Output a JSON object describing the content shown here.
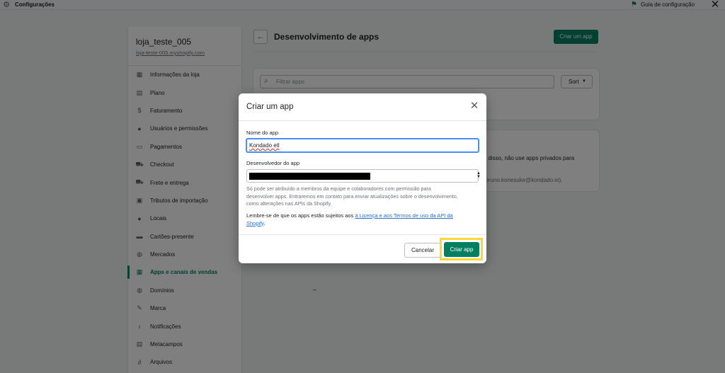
{
  "topbar": {
    "title": "Configurações",
    "guide_label": "Guia de configuração"
  },
  "sidebar": {
    "store_name": "loja_teste_005",
    "store_url": "loja-teste-005.myshopify.com",
    "items": [
      {
        "label": "Informações da loja",
        "icon": "store-icon",
        "active": false
      },
      {
        "label": "Plano",
        "icon": "plan-icon",
        "active": false
      },
      {
        "label": "Faturamento",
        "icon": "billing-icon",
        "active": false
      },
      {
        "label": "Usuários e permissões",
        "icon": "user-icon",
        "active": false
      },
      {
        "label": "Pagamentos",
        "icon": "payments-icon",
        "active": false
      },
      {
        "label": "Checkout",
        "icon": "cart-icon",
        "active": false
      },
      {
        "label": "Frete e entrega",
        "icon": "truck-icon",
        "active": false
      },
      {
        "label": "Tributos de importação",
        "icon": "duties-icon",
        "active": false
      },
      {
        "label": "Locais",
        "icon": "location-icon",
        "active": false
      },
      {
        "label": "Cartões-presente",
        "icon": "gift-card-icon",
        "active": false
      },
      {
        "label": "Mercados",
        "icon": "globe-icon",
        "active": false
      },
      {
        "label": "Apps e canais de vendas",
        "icon": "apps-icon",
        "active": true
      },
      {
        "label": "Domínios",
        "icon": "domains-icon",
        "active": false
      },
      {
        "label": "Marca",
        "icon": "brand-icon",
        "active": false
      },
      {
        "label": "Notificações",
        "icon": "bell-icon",
        "active": false
      },
      {
        "label": "Metacampos",
        "icon": "metafields-icon",
        "active": false
      },
      {
        "label": "Arquivos",
        "icon": "paperclip-icon",
        "active": false
      }
    ]
  },
  "main": {
    "page_title": "Desenvolvimento de apps",
    "create_button": "Criar um app",
    "search_placeholder": "Filtrar apps",
    "sort_label": "Sort",
    "card_text_1": "ém disso, não use apps privados para",
    "card_text_2": "e (bruno.konesuke@kondado.io).",
    "dash": "–"
  },
  "modal": {
    "title": "Criar um app",
    "name_label": "Nome do app",
    "name_value": "Kondado etl",
    "developer_label": "Desenvolvedor do app",
    "help_text": "Só pode ser atribuído a membros da equipe e colaboradores com permissão para desenvolver apps. Entraremos em contato para enviar atualizações sobre o desenvolvimento, como alterações nas APIs da Shopify.",
    "terms_prefix": "Lembre-se de que os apps estão sujeitos aos ",
    "terms_link": "à Licença e aos Termos de uso da API da Shopify",
    "terms_suffix": ".",
    "cancel_button": "Cancelar",
    "create_button": "Criar app"
  },
  "colors": {
    "primary_green": "#008060",
    "highlight_yellow": "#fdd835",
    "focus_blue": "#458fff"
  }
}
